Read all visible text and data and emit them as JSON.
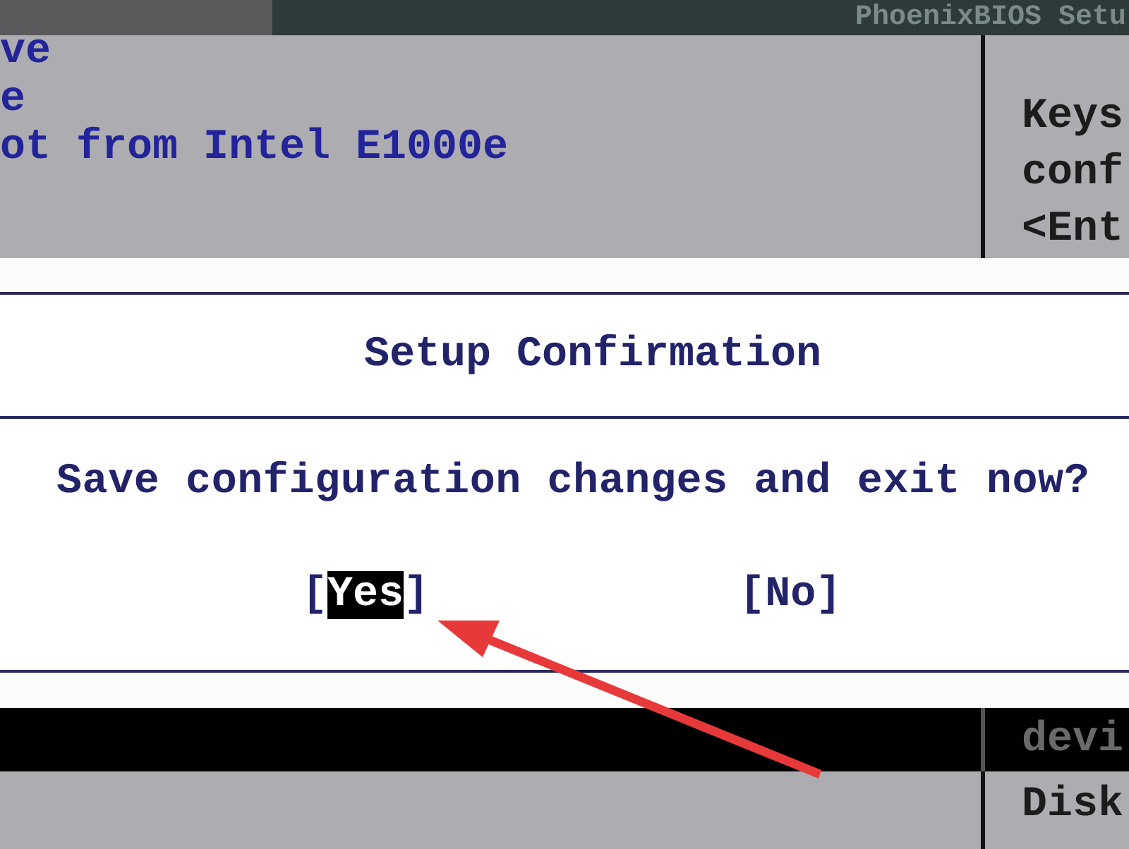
{
  "header": {
    "title": "PhoenixBIOS Setu"
  },
  "menu_lines": [
    "ve",
    "e",
    "ot from Intel E1000e"
  ],
  "help_lines": [
    "Keys",
    "conf",
    "<Ent"
  ],
  "dialog": {
    "title": "Setup Confirmation",
    "message": "Save configuration changes and exit now?",
    "buttons": [
      {
        "open": "[",
        "label": "Yes",
        "close": "]",
        "selected": true
      },
      {
        "open": "[",
        "label": "No",
        "close": "]",
        "selected": false
      }
    ]
  },
  "bottom": {
    "selected_row_help": "devi",
    "help_line": "Disk"
  }
}
